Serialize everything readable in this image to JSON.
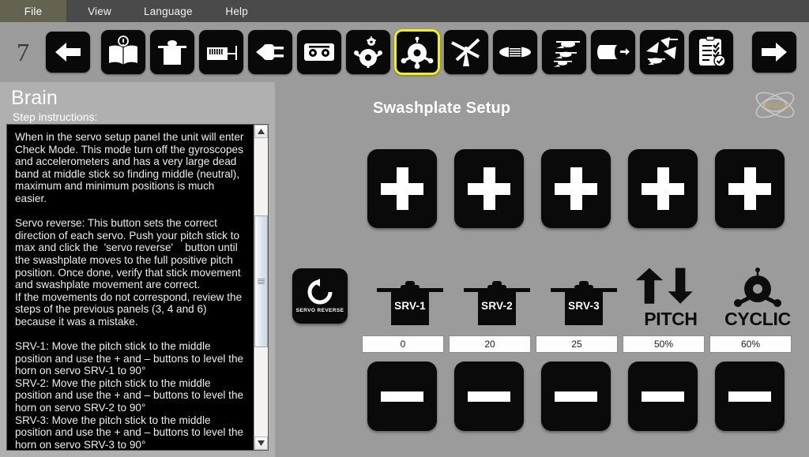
{
  "menubar": {
    "items": [
      {
        "label": "File",
        "active": true
      },
      {
        "label": "View",
        "active": false
      },
      {
        "label": "Language",
        "active": false
      },
      {
        "label": "Help",
        "active": false
      }
    ]
  },
  "toolbar": {
    "step_number": "7",
    "back_icon": "arrow-left-icon",
    "forward_icon": "arrow-right-icon",
    "steps": [
      {
        "name": "manual-book-icon",
        "selected": false
      },
      {
        "name": "servo-icon",
        "selected": false
      },
      {
        "name": "receiver-icon",
        "selected": false
      },
      {
        "name": "connector-plug-icon",
        "selected": false
      },
      {
        "name": "transmitter-icon",
        "selected": false
      },
      {
        "name": "swashplate-type-icon",
        "selected": false
      },
      {
        "name": "swashplate-setup-icon",
        "selected": true
      },
      {
        "name": "tail-rotor-icon",
        "selected": false
      },
      {
        "name": "helicopter-body-icon",
        "selected": false
      },
      {
        "name": "helicopter-sizes-icon",
        "selected": false
      },
      {
        "name": "gyro-drum-icon",
        "selected": false
      },
      {
        "name": "flight-test-icon",
        "selected": false
      },
      {
        "name": "checklist-done-icon",
        "selected": false
      }
    ]
  },
  "left_panel": {
    "title": "Brain",
    "subtitle": "Step instructions:",
    "instructions": "When in the servo setup panel the unit will enter Check Mode. This mode turn off the gyroscopes and accelerometers and has a very large dead band at middle stick so finding middle (neutral), maximum and minimum positions is much easier.\n\nServo reverse: This button sets the correct direction of each servo. Push your pitch stick to max and click the  'servo reverse'    button until the swashplate moves to the full positive pitch position. Once done, verify that stick movement and swashplate movement are correct.\nIf the movements do not correspond, review the steps of the previous panels (3, 4 and 6) because it was a mistake.\n\nSRV-1: Move the pitch stick to the middle position and use the + and – buttons to level the horn on servo SRV-1 to 90°\nSRV-2: Move the pitch stick to the middle position and use the + and – buttons to level the horn on servo SRV-2 to 90°\nSRV-3: Move the pitch stick to the middle position and use the + and – buttons to level the horn on servo SRV-3 to 90°\nIf the correction values are too great (red values),",
    "scrollbar": {
      "up_icon": "scroll-up-icon",
      "down_icon": "scroll-down-icon"
    }
  },
  "main": {
    "title": "Swashplate Setup",
    "logo_text": "Brain",
    "servo_reverse": {
      "label": "SERVO REVERSE",
      "icon": "rotate-ccw-icon"
    },
    "channels": [
      {
        "label": "SRV-1",
        "icon": "servo-icon",
        "value": "0",
        "plus": "+",
        "minus": "–"
      },
      {
        "label": "SRV-2",
        "icon": "servo-icon",
        "value": "20",
        "plus": "+",
        "minus": "–"
      },
      {
        "label": "SRV-3",
        "icon": "servo-icon",
        "value": "25",
        "plus": "+",
        "minus": "–"
      },
      {
        "label": "PITCH",
        "icon": "pitch-arrows-icon",
        "value": "50%",
        "plus": "+",
        "minus": "–"
      },
      {
        "label": "CYCLIC",
        "icon": "swashplate-icon",
        "value": "60%",
        "plus": "+",
        "minus": "–"
      }
    ]
  },
  "colors": {
    "menu_bg": "#4a4a4a",
    "menu_active": "#636350",
    "panel_bg": "#9b9b9b",
    "left_bg": "#b0b0b0",
    "button_black": "#0a0a0a",
    "selected_outline": "#f2f20a",
    "instruction_bg": "#000000",
    "instruction_text": "#ededed"
  }
}
